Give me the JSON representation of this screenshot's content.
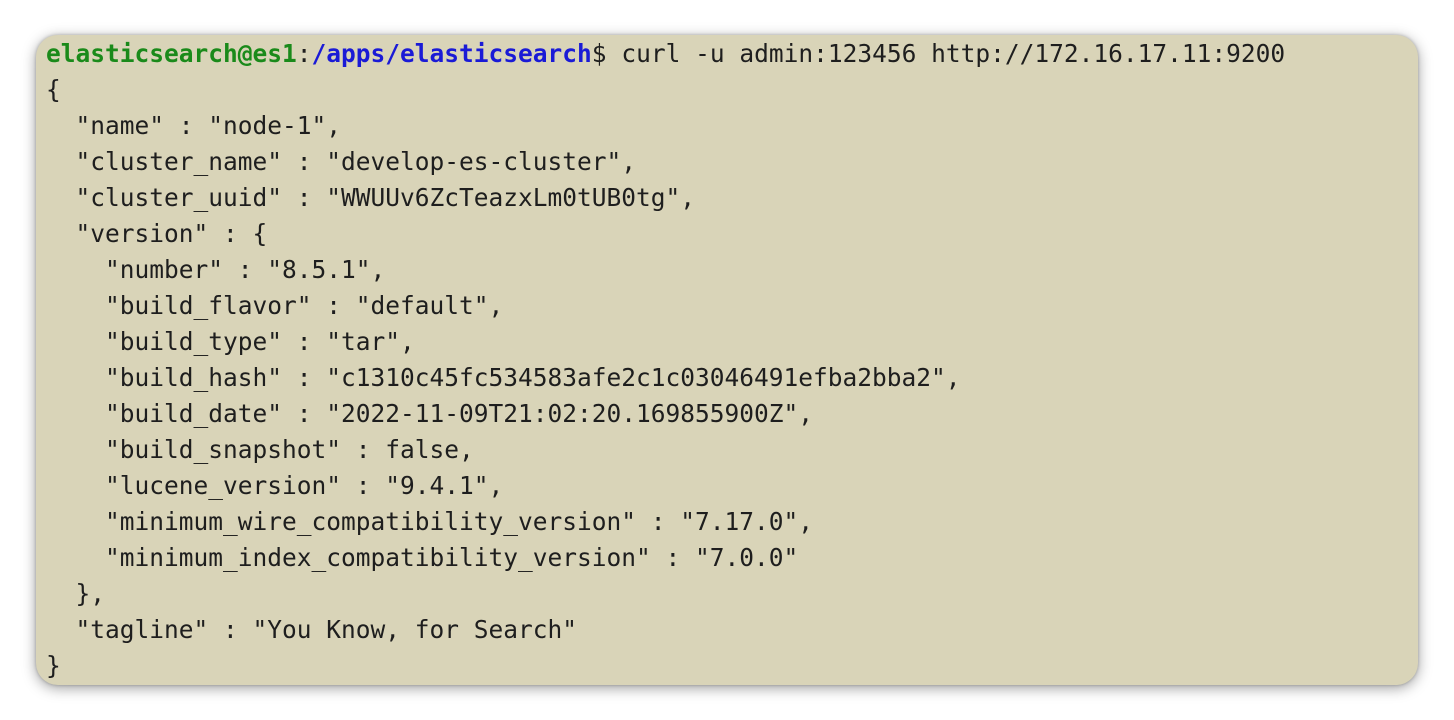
{
  "prompt": {
    "user_host": "elasticsearch@es1",
    "separator": ":",
    "path": "/apps/elasticsearch",
    "symbol": "$",
    "command": " curl -u admin:123456 http://172.16.17.11:9200"
  },
  "output_lines": [
    "{",
    "  \"name\" : \"node-1\",",
    "  \"cluster_name\" : \"develop-es-cluster\",",
    "  \"cluster_uuid\" : \"WWUUv6ZcTeazxLm0tUB0tg\",",
    "  \"version\" : {",
    "    \"number\" : \"8.5.1\",",
    "    \"build_flavor\" : \"default\",",
    "    \"build_type\" : \"tar\",",
    "    \"build_hash\" : \"c1310c45fc534583afe2c1c03046491efba2bba2\",",
    "    \"build_date\" : \"2022-11-09T21:02:20.169855900Z\",",
    "    \"build_snapshot\" : false,",
    "    \"lucene_version\" : \"9.4.1\",",
    "    \"minimum_wire_compatibility_version\" : \"7.17.0\",",
    "    \"minimum_index_compatibility_version\" : \"7.0.0\"",
    "  },",
    "  \"tagline\" : \"You Know, for Search\"",
    "}"
  ],
  "colors": {
    "background": "#d9d4b8",
    "user_host": "#1a8a1a",
    "path": "#1a1ad6",
    "text": "#1e1e1e"
  }
}
